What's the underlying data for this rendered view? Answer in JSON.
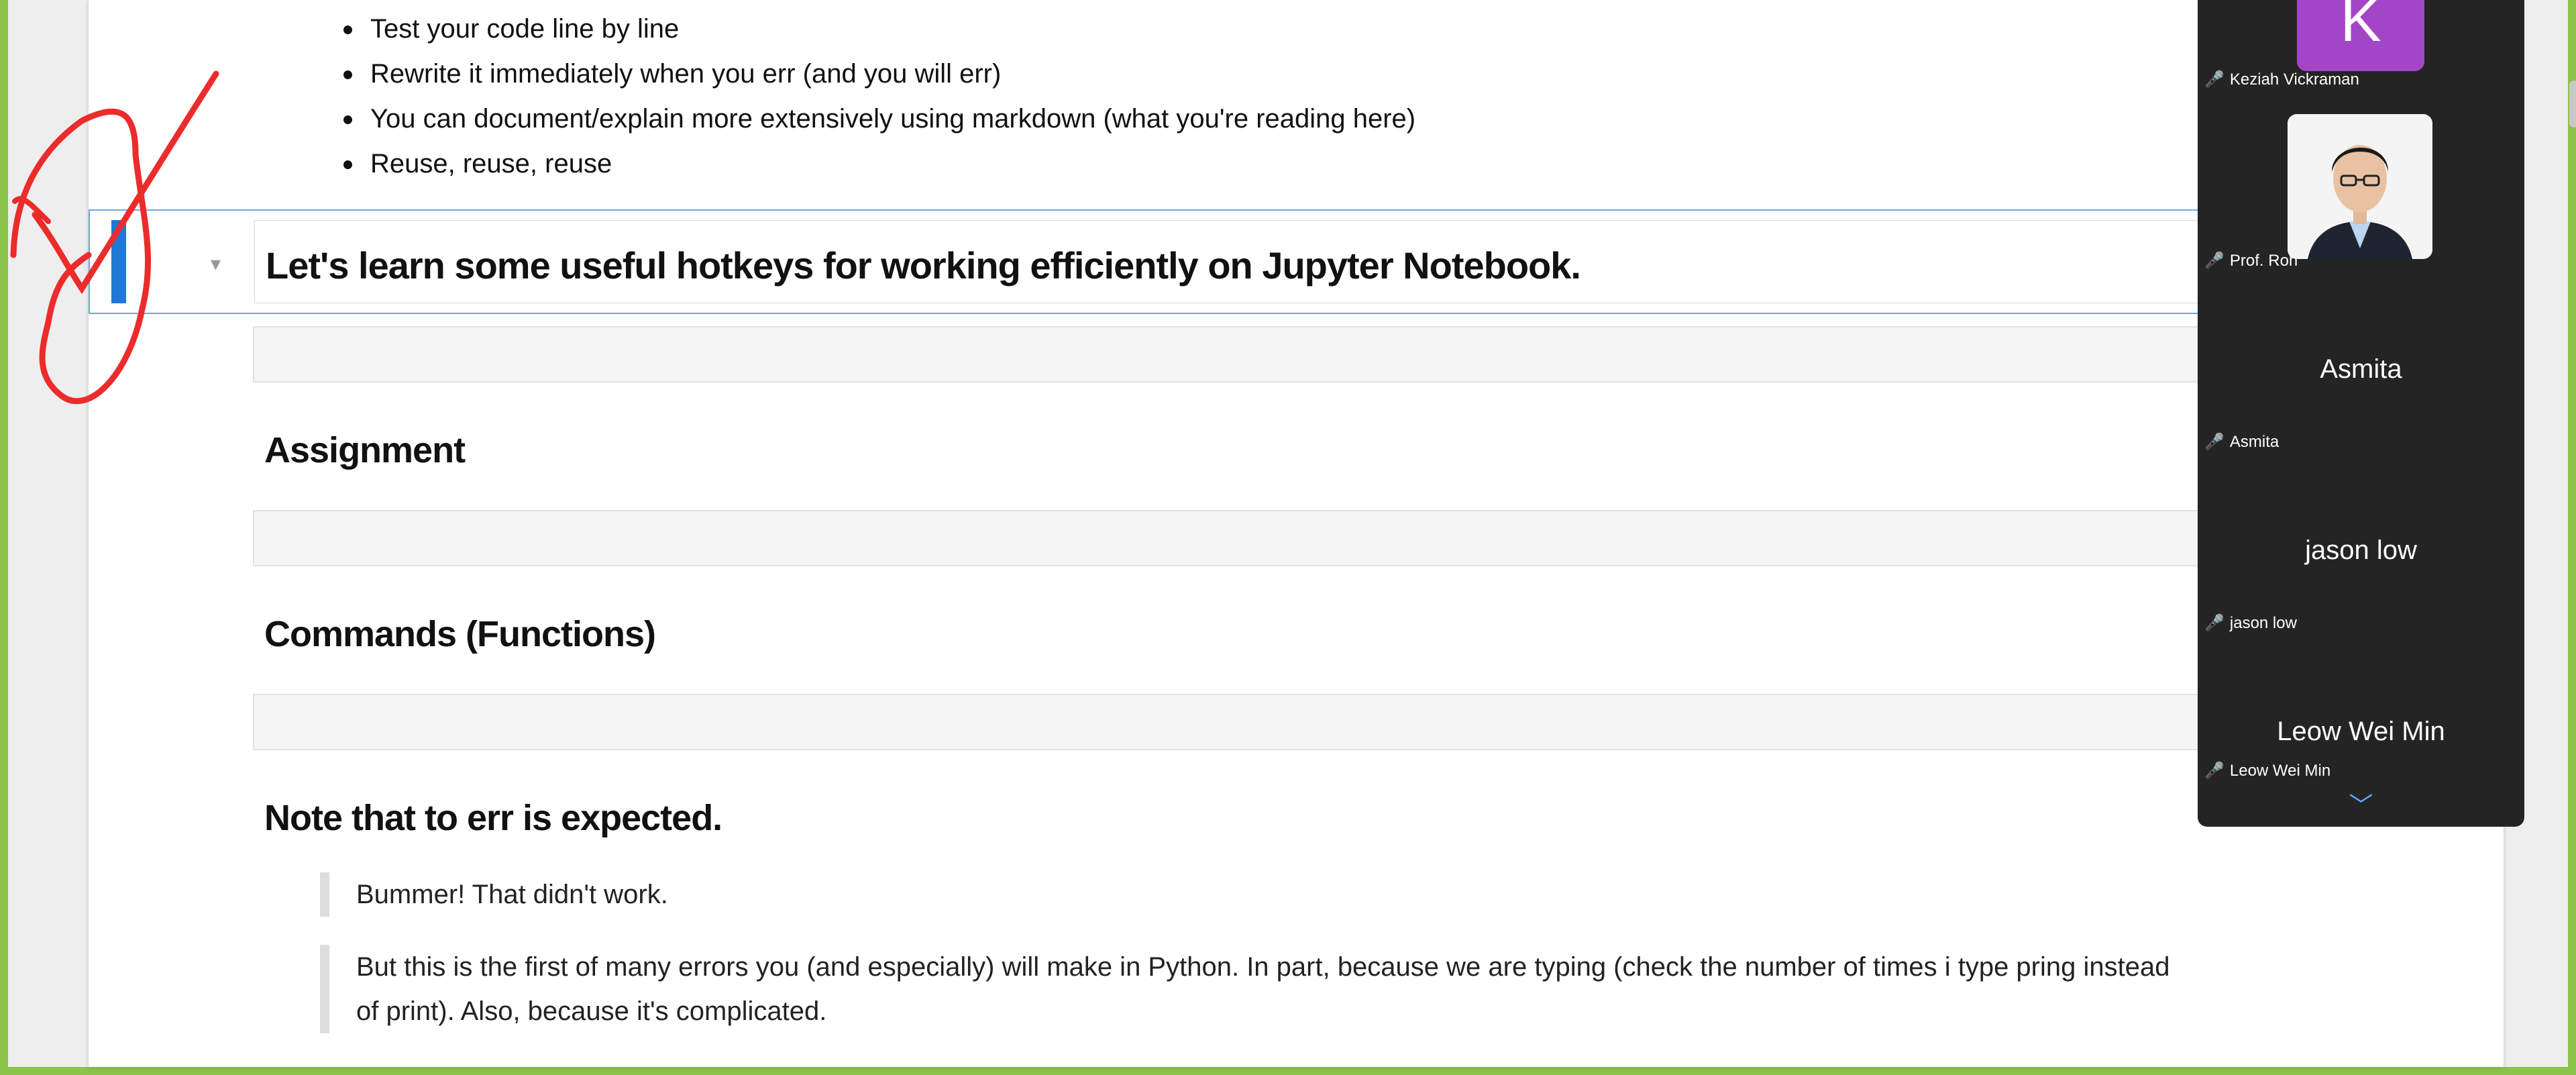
{
  "notebook": {
    "bullets": [
      "Test your code line by line",
      "Rewrite it immediately when you err (and you will err)",
      "You can document/explain more extensively using markdown (what you're reading here)",
      "Reuse, reuse, reuse"
    ],
    "selected_heading": "Let's learn some useful hotkeys for working efficiently on Jupyter Notebook.",
    "prompt_empty": "[ ]:",
    "prompt_partial": "[ :",
    "heading_assignment": "Assignment",
    "heading_commands": "Commands (Functions)",
    "heading_note": "Note that to err is expected.",
    "quote1": "Bummer! That didn't work.",
    "quote2_line1": "But this is the first of many errors you (and especially) will make in Python. In part, because we are typing (check the number of times i type pring instead",
    "quote2_line2": "of print). Also, because it's complicated."
  },
  "participants": [
    {
      "name": "Keziah Vickraman",
      "initial": "K",
      "avatar_color": "#a246c7"
    },
    {
      "name": "Prof. Roh",
      "photo": true
    },
    {
      "name": "Asmita",
      "display": "Asmita"
    },
    {
      "name": "jason low",
      "display": "jason low"
    },
    {
      "name": "Leow Wei Min",
      "display": "Leow Wei Min"
    }
  ],
  "icons": {
    "mic_muted": "muted-mic-icon",
    "copy": "copy-icon",
    "chevron": "chevron-down-icon"
  }
}
